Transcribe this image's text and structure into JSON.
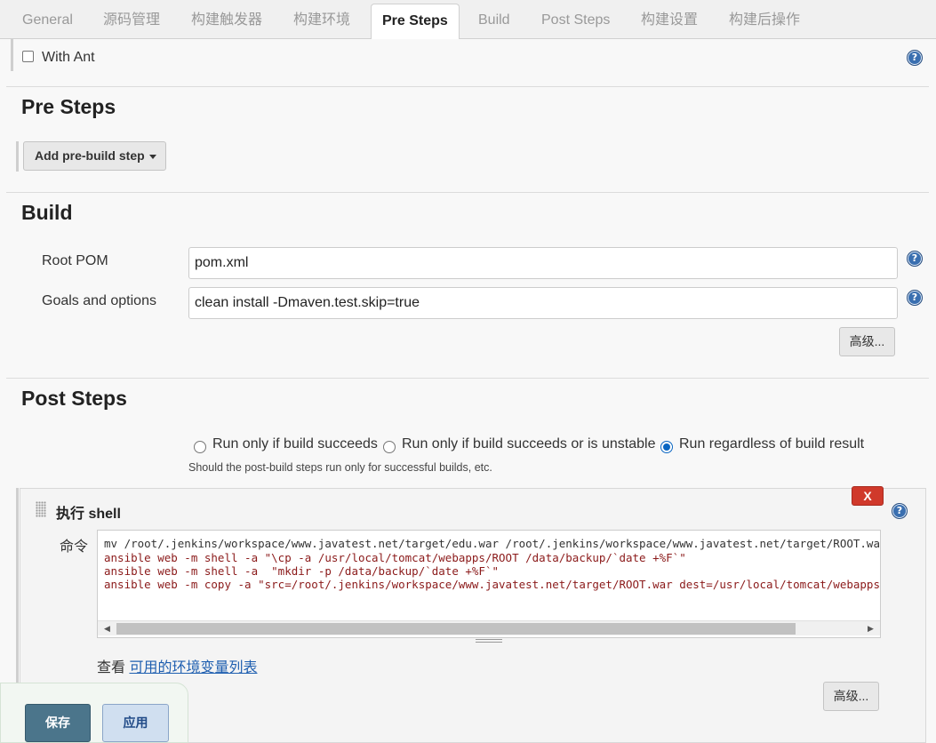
{
  "tabs": [
    {
      "label": "General"
    },
    {
      "label": "源码管理"
    },
    {
      "label": "构建触发器"
    },
    {
      "label": "构建环境"
    },
    {
      "label": "Pre Steps"
    },
    {
      "label": "Build"
    },
    {
      "label": "Post Steps"
    },
    {
      "label": "构建设置"
    },
    {
      "label": "构建后操作"
    }
  ],
  "active_tab": "Pre Steps",
  "with_ant": {
    "label": "With Ant",
    "checked": false
  },
  "pre_steps": {
    "title": "Pre Steps",
    "add_button": "Add pre-build step"
  },
  "build": {
    "title": "Build",
    "root_pom_label": "Root POM",
    "root_pom_value": "pom.xml",
    "goals_label": "Goals and options",
    "goals_value": "clean install -Dmaven.test.skip=true",
    "advanced_button": "高级..."
  },
  "post_steps": {
    "title": "Post Steps",
    "radio_options": [
      {
        "label": "Run only if build succeeds",
        "checked": false
      },
      {
        "label": "Run only if build succeeds or is unstable",
        "checked": false
      },
      {
        "label": "Run regardless of build result",
        "checked": true
      }
    ],
    "hint": "Should the post-build steps run only for successful builds, etc."
  },
  "shell_step": {
    "title": "执行 shell",
    "delete_label": "X",
    "command_label": "命令",
    "command_lines": [
      "mv /root/.jenkins/workspace/www.javatest.net/target/edu.war /root/.jenkins/workspace/www.javatest.net/target/ROOT.war",
      "ansible web -m shell -a \"\\cp -a /usr/local/tomcat/webapps/ROOT /data/backup/`date +%F`\"",
      "ansible web -m shell -a  \"mkdir -p /data/backup/`date +%F`\"",
      "ansible web -m copy -a \"src=/root/.jenkins/workspace/www.javatest.net/target/ROOT.war dest=/usr/local/tomcat/webapps/\""
    ],
    "env_prefix": "查看",
    "env_link": "可用的环境变量列表",
    "advanced_button": "高级..."
  },
  "footer": {
    "save_label": "保存",
    "apply_label": "应用"
  },
  "colors": {
    "accent": "#4b758b",
    "link": "#1f5fb0",
    "danger": "#d0392b",
    "radio_checked": "#0a66c2"
  }
}
